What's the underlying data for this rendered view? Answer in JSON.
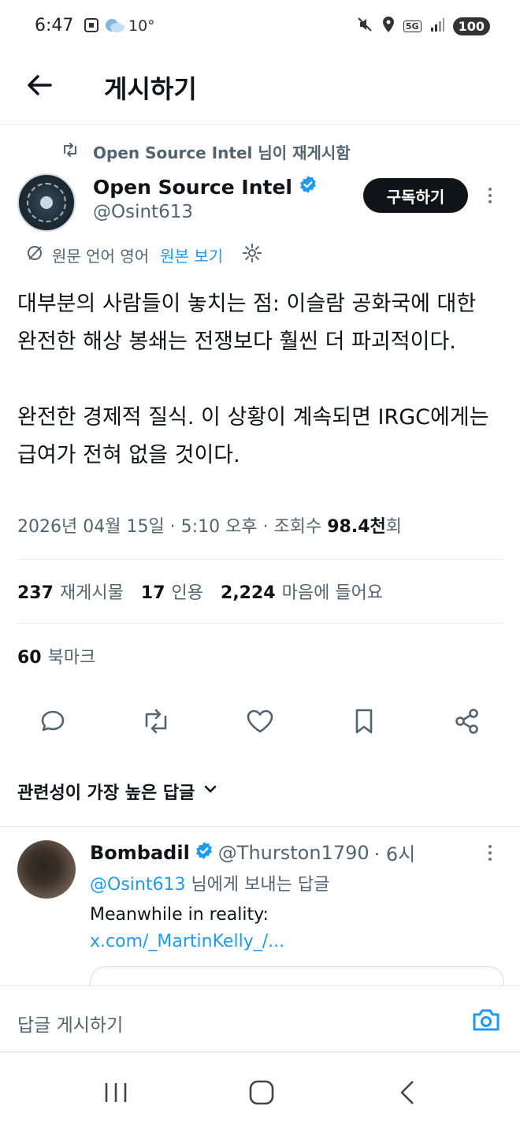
{
  "status_bar": {
    "time": "6:47",
    "temp": "10°",
    "battery": "100",
    "network": "5G"
  },
  "header": {
    "title": "게시하기"
  },
  "post": {
    "reposted_by": "Open Source Intel 님이 재게시함",
    "author_name": "Open Source Intel",
    "author_handle": "@Osint613",
    "subscribe_label": "구독하기",
    "translate_info": "원문 언어 영어",
    "translate_link": "원본 보기",
    "paragraph1": "대부분의 사람들이 놓치는 점: 이슬람 공화국에 대한 완전한 해상 봉쇄는 전쟁보다 훨씬 더 파괴적이다.",
    "paragraph2": "완전한 경제적 질식. 이 상황이 계속되면 IRGC에게는 급여가 전혀 없을 것이다.",
    "meta_date": "2026년 04월 15일 · 5:10 오후 · 조회수 ",
    "views": "98.4천",
    "views_suffix": "회",
    "reposts_count": "237",
    "reposts_label": "재게시물",
    "quotes_count": "17",
    "quotes_label": "인용",
    "likes_count": "2,224",
    "likes_label": "마음에 들어요",
    "bookmarks_count": "60",
    "bookmarks_label": "북마크"
  },
  "replies": {
    "sort_label": "관련성이 가장 높은 답글",
    "items": [
      {
        "name": "Bombadil",
        "handle": "@Thurston1790",
        "time": "· 6시",
        "reply_to_handle": "@Osint613",
        "reply_to_suffix": " 님에게 보내는 답글",
        "text": "Meanwhile in reality:",
        "link": "x.com/_MartinKelly_/..."
      }
    ]
  },
  "composer": {
    "placeholder": "답글 게시하기"
  },
  "colors": {
    "accent": "#1d9bf0",
    "text": "#0f1419",
    "muted": "#536471"
  }
}
